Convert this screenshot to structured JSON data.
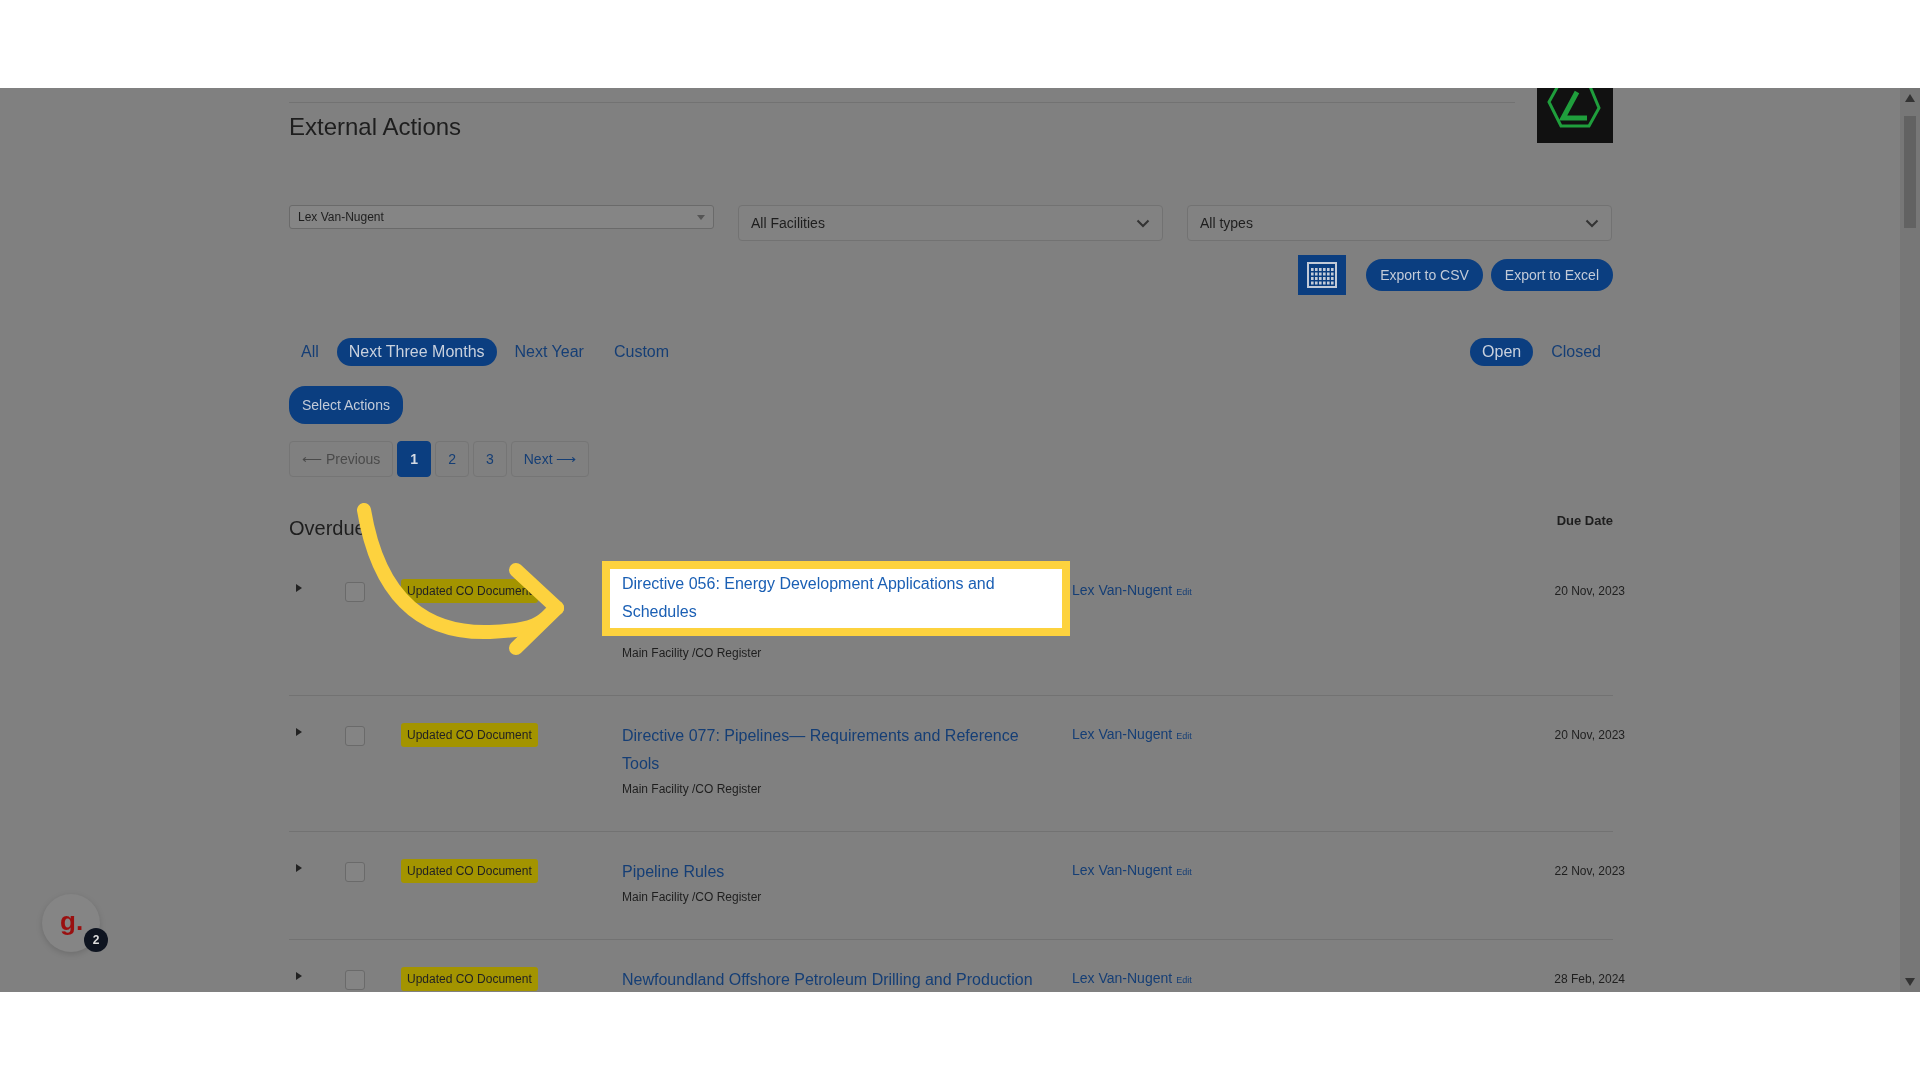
{
  "header": {
    "title": "External Actions"
  },
  "filters": [
    {
      "kind": "select",
      "value": "Lex Van-Nugent"
    },
    {
      "kind": "dropdown",
      "value": "All Facilities"
    },
    {
      "kind": "dropdown",
      "value": "All types"
    }
  ],
  "export_buttons": [
    "Export to CSV",
    "Export to Excel"
  ],
  "period_tabs": [
    {
      "label": "All",
      "selected": false
    },
    {
      "label": "Next Three Months",
      "selected": true
    },
    {
      "label": "Next Year",
      "selected": false
    },
    {
      "label": "Custom",
      "selected": false
    }
  ],
  "status_tabs": [
    {
      "label": "Open",
      "selected": true
    },
    {
      "label": "Closed",
      "selected": false
    }
  ],
  "select_actions": "Select Actions",
  "pagination": {
    "previous": {
      "label": "⟵ Previous",
      "disabled": true
    },
    "pages": [
      {
        "label": "1",
        "selected": true
      },
      {
        "label": "2",
        "selected": false
      },
      {
        "label": "3",
        "selected": false
      }
    ],
    "next": {
      "label": "Next ⟶",
      "disabled": false
    }
  },
  "section": {
    "title": "Overdue",
    "due_column": "Due Date"
  },
  "rows": [
    {
      "badge": "Updated CO Document",
      "title": "Directive 056: Energy Development Applications and Schedules",
      "subtitle": "Main Facility /CO Register",
      "assignee": "Lex Van-Nugent",
      "edit": "Edit",
      "due": "20 Nov, 2023",
      "checked": false,
      "highlighted": true
    },
    {
      "badge": "Updated CO Document",
      "title": "Directive 077: Pipelines— Requirements and Reference Tools",
      "subtitle": "Main Facility /CO Register",
      "assignee": "Lex Van-Nugent",
      "edit": "Edit",
      "due": "20 Nov, 2023",
      "checked": false,
      "highlighted": false
    },
    {
      "badge": "Updated CO Document",
      "title": "Pipeline Rules",
      "subtitle": "Main Facility /CO Register",
      "assignee": "Lex Van-Nugent",
      "edit": "Edit",
      "due": "22 Nov, 2023",
      "checked": false,
      "highlighted": false
    },
    {
      "badge": "Updated CO Document",
      "title": "Newfoundland Offshore Petroleum Drilling and Production",
      "assignee": "Lex Van-Nugent",
      "edit": "Edit",
      "due": "28 Feb, 2024",
      "checked": false,
      "highlighted": false
    }
  ],
  "help_widget": {
    "logo": "g.",
    "count": "2"
  }
}
